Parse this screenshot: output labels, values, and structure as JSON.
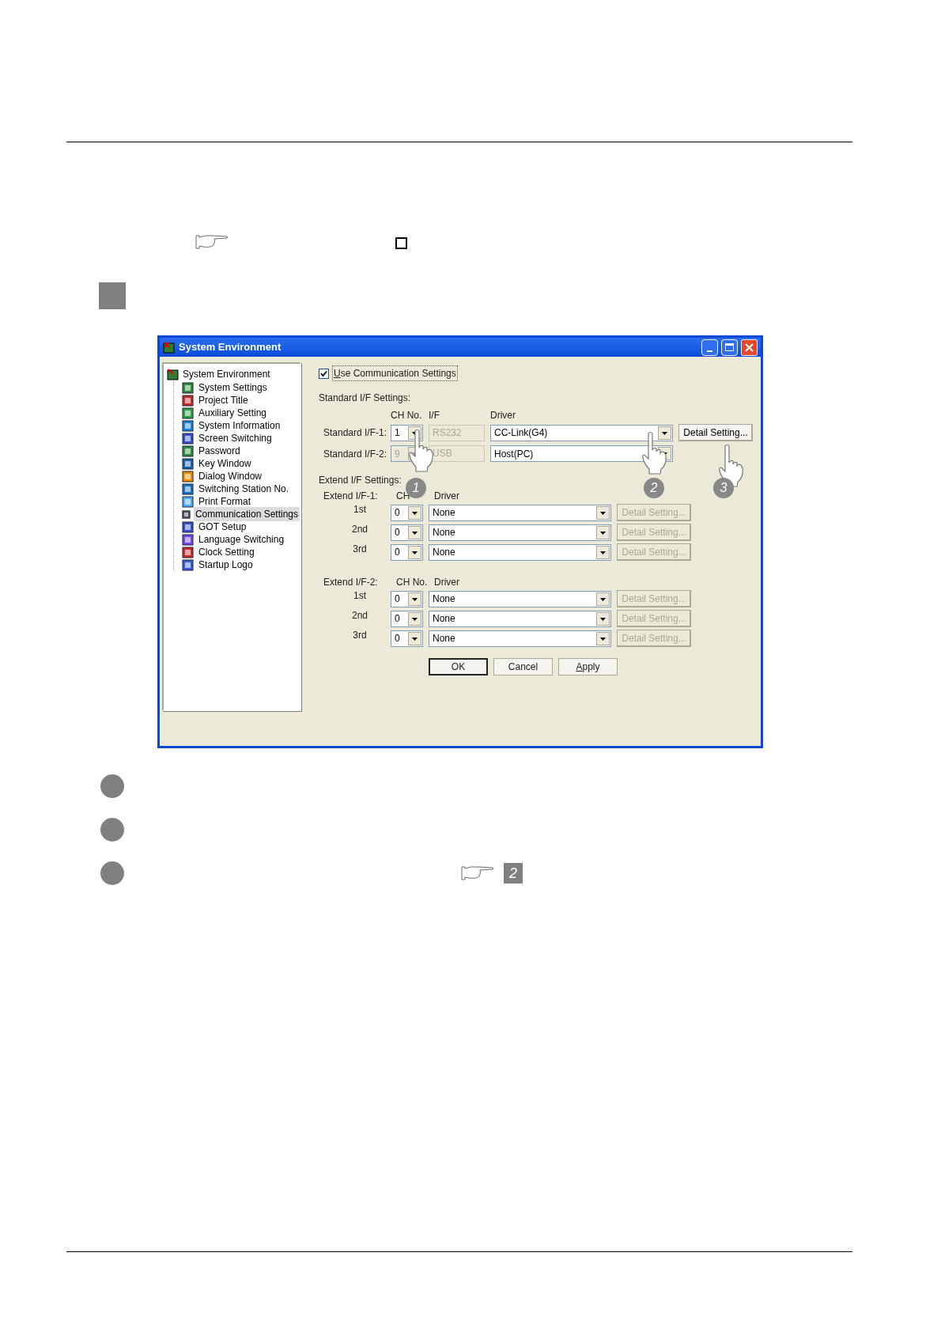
{
  "window": {
    "title": "System Environment"
  },
  "tree": {
    "label": "System Environment",
    "children": [
      {
        "label": "System Settings",
        "selected": false
      },
      {
        "label": "Project Title",
        "selected": false
      },
      {
        "label": "Auxiliary Setting",
        "selected": false
      },
      {
        "label": "System Information",
        "selected": false
      },
      {
        "label": "Screen Switching",
        "selected": false
      },
      {
        "label": "Password",
        "selected": false
      },
      {
        "label": "Key Window",
        "selected": false
      },
      {
        "label": "Dialog Window",
        "selected": false
      },
      {
        "label": "Switching Station No.",
        "selected": false
      },
      {
        "label": "Print Format",
        "selected": false
      },
      {
        "label": "Communication Settings",
        "selected": true
      },
      {
        "label": "GOT Setup",
        "selected": false
      },
      {
        "label": "Language Switching",
        "selected": false
      },
      {
        "label": "Clock Setting",
        "selected": false
      },
      {
        "label": "Startup Logo",
        "selected": false
      }
    ]
  },
  "use_communication_settings": {
    "label": "Use Communication Settings",
    "checked": true,
    "underline_first": true
  },
  "standard_if": {
    "title": "Standard I/F Settings:",
    "headers": [
      "CH No.",
      "I/F",
      "Driver"
    ],
    "rows": [
      {
        "label": "Standard I/F-1:",
        "ch": "1",
        "ch_disabled": false,
        "if": "RS232",
        "driver": "CC-Link(G4)",
        "button": "Detail Setting..."
      },
      {
        "label": "Standard I/F-2:",
        "ch": "9",
        "ch_disabled": true,
        "if": "USB",
        "driver": "Host(PC)"
      }
    ]
  },
  "extend_if": {
    "title": "Extend I/F Settings:",
    "groups": [
      {
        "label": "Extend I/F-1:",
        "headers": [
          "CH",
          "Driver"
        ],
        "rows": [
          {
            "label": "1st",
            "ch": "0",
            "driver": "None",
            "button": "Detail Setting...",
            "button_disabled": true
          },
          {
            "label": "2nd",
            "ch": "0",
            "driver": "None",
            "button": "Detail Setting...",
            "button_disabled": true
          },
          {
            "label": "3rd",
            "ch": "0",
            "driver": "None",
            "button": "Detail Setting...",
            "button_disabled": true
          }
        ]
      },
      {
        "label": "Extend I/F-2:",
        "headers": [
          "CH No.",
          "Driver"
        ],
        "rows": [
          {
            "label": "1st",
            "ch": "0",
            "driver": "None",
            "button": "Detail Setting...",
            "button_disabled": true
          },
          {
            "label": "2nd",
            "ch": "0",
            "driver": "None",
            "button": "Detail Setting...",
            "button_disabled": true
          },
          {
            "label": "3rd",
            "ch": "0",
            "driver": "None",
            "button": "Detail Setting...",
            "button_disabled": true
          }
        ]
      }
    ]
  },
  "buttons": [
    {
      "label": "OK",
      "default": true,
      "underline_first": false
    },
    {
      "label": "Cancel",
      "default": false,
      "underline_first": false
    },
    {
      "label": "Apply",
      "default": false,
      "underline_first": true
    }
  ],
  "callouts": [
    "1",
    "2",
    "3"
  ],
  "reference_badge": "2"
}
